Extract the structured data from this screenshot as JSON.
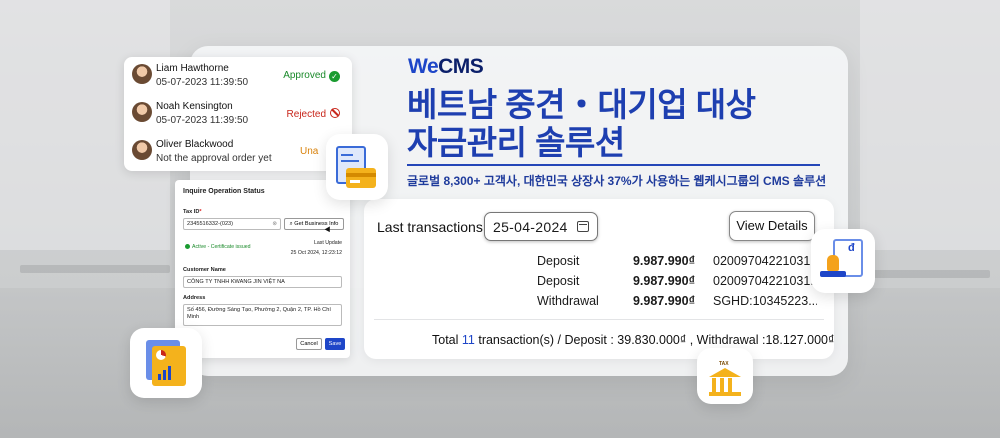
{
  "brand": {
    "we": "We",
    "cms": "CMS"
  },
  "headline": {
    "line1": "베트남 중견・대기업 대상",
    "line2": "자금관리 솔루션"
  },
  "subline": "글로벌 8,300+ 고객사, 대한민국 상장사 37%가 사용하는 웹케시그룹의 CMS 솔루션",
  "transactions": {
    "label": "Last transactions:",
    "date": "25-04-2024",
    "view_details": "View Details",
    "rows": [
      {
        "type": "Deposit",
        "amount": "9.987.990₫",
        "ref": "02009704221031..."
      },
      {
        "type": "Deposit",
        "amount": "9.987.990₫",
        "ref": "02009704221031..."
      },
      {
        "type": "Withdrawal",
        "amount": "9.987.990₫",
        "ref": "SGHD:10345223..."
      }
    ],
    "total_prefix": "Total ",
    "total_count": "11",
    "total_suffix": " transaction(s) / Deposit : 39.830.000₫ , Withdrawal :18.127.000₫"
  },
  "approvals": [
    {
      "name": "Liam Hawthorne",
      "sub": "05-07-2023 11:39:50",
      "status": "Approved"
    },
    {
      "name": "Noah Kensington",
      "sub": "05-07-2023 11:39:50",
      "status": "Rejected"
    },
    {
      "name": "Oliver Blackwood",
      "sub": "Not the approval order yet",
      "status": "Una"
    }
  ],
  "form": {
    "title": "Inquire Operation Status",
    "tax_id_label": "Tax ID",
    "tax_id_required": "*",
    "tax_id_value": "2345516332-(023)",
    "clear_glyph": "⊗",
    "get_info": "Get Business Info",
    "active_text": "Active - Certificate issued",
    "last_update_label": "Last Update",
    "last_update_value": "25 Oct 2024, 12:23:12",
    "customer_name_label": "Customer Name",
    "customer_name_value": "CÔNG TY TNHH KWANG JIN VIỆT NA",
    "address_label": "Address",
    "address_value": "Số 456, Đường Sáng Tạo, Phường 2, Quận 2, TP. Hồ Chí Minh",
    "cancel": "Cancel",
    "save": "Save"
  },
  "icon_text": {
    "tax": "TAX",
    "dong": "đ"
  },
  "colors": {
    "accent": "#1e46c8",
    "approved": "#1a8a2a",
    "rejected": "#c8261b",
    "pending": "#d9820b"
  }
}
